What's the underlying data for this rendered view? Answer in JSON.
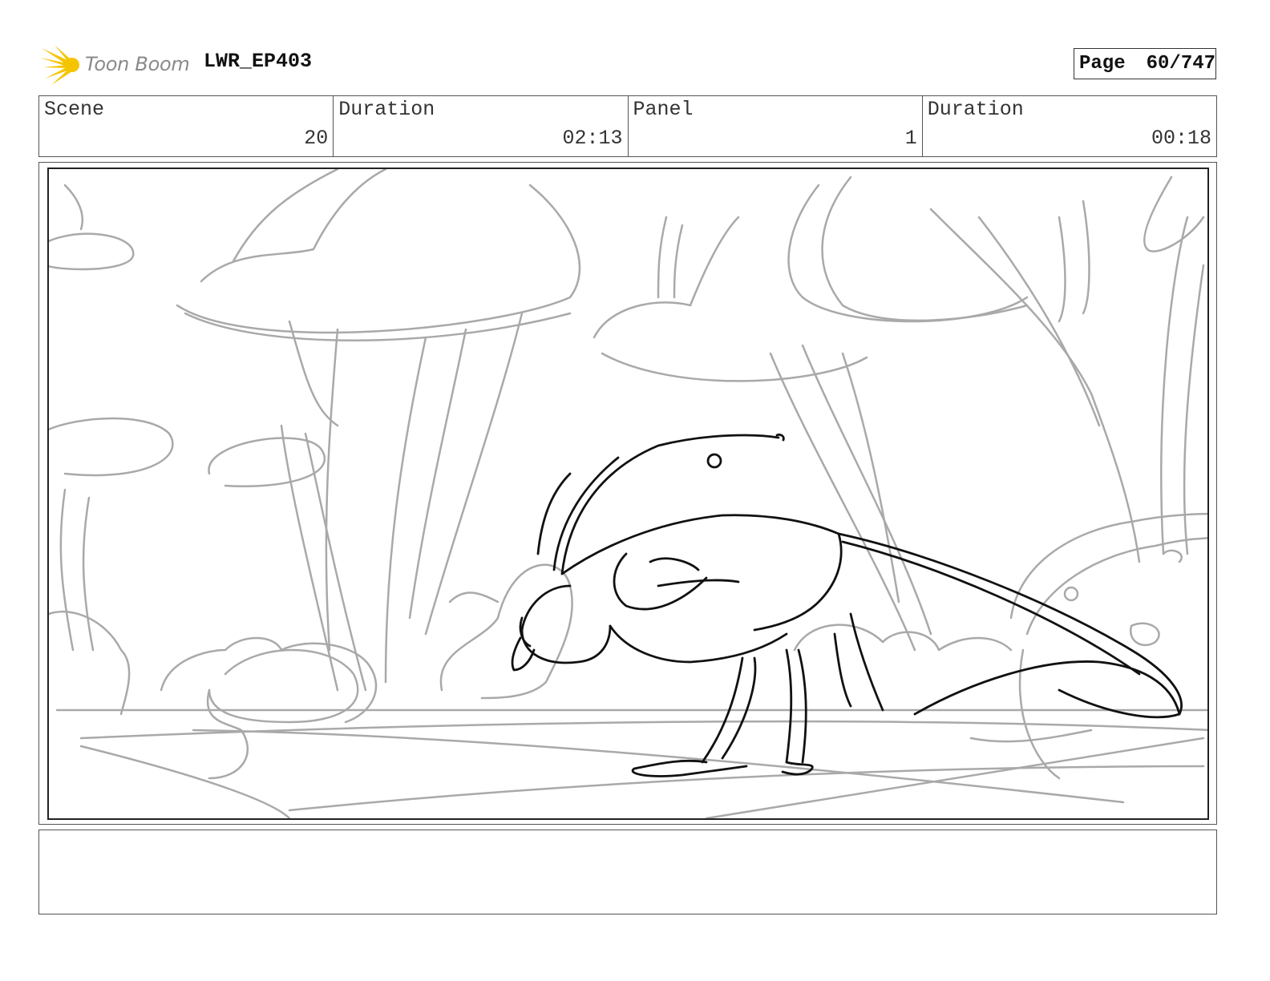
{
  "header": {
    "logo_text": "Toon Boom",
    "project": "LWR_EP403",
    "page_label": "Page",
    "page_number": "60/747"
  },
  "info": {
    "scene_label": "Scene",
    "scene_value": "20",
    "scene_duration_label": "Duration",
    "scene_duration_value": "02:13",
    "panel_label": "Panel",
    "panel_value": "1",
    "panel_duration_label": "Duration",
    "panel_duration_value": "00:18"
  },
  "colors": {
    "logo_yellow": "#f5c400",
    "background_sketch": "#a9a9a9",
    "character_ink": "#111111"
  },
  "notes": {
    "text": ""
  }
}
